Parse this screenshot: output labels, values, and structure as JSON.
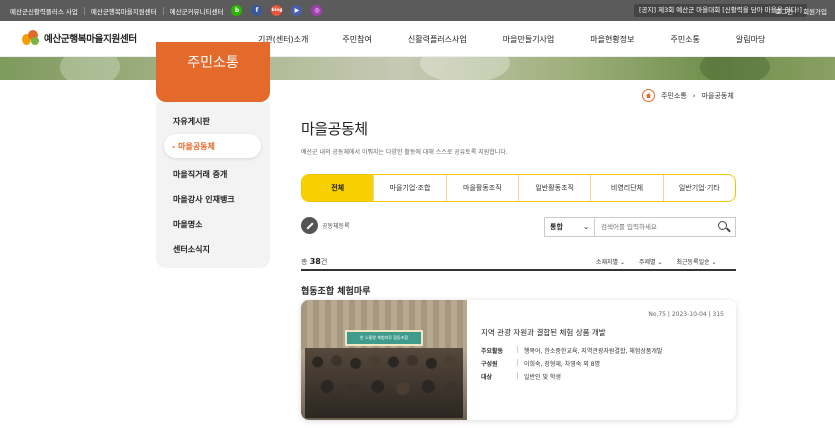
{
  "topbar": {
    "links": [
      "예산군신활력플러스 사업",
      "예산군행복마을지원센터",
      "예산군커뮤니티센터"
    ],
    "sns": [
      {
        "label": "b",
        "icon": "blog-icon",
        "color": "#2db400"
      },
      {
        "label": "f",
        "icon": "facebook-icon",
        "color": "#3b5998"
      },
      {
        "label": "blog",
        "icon": "naver-blog-icon",
        "color": "#e8543c"
      },
      {
        "label": "▶",
        "icon": "youtube-icon",
        "color": "#4c5fa8"
      },
      {
        "label": "◎",
        "icon": "instagram-icon",
        "color": "#a23fb1"
      }
    ],
    "notice": "[공지] 제3회 예산군 마을대회 [신활력을 담아 마을을 잇다!]",
    "login": "로그인",
    "signup": "회원가입"
  },
  "header": {
    "logo": "예산군행복마을지원센터",
    "nav": [
      "기관(센터)소개",
      "주민참여",
      "신활력플러스사업",
      "마을만들기사업",
      "마을현황정보",
      "주민소통",
      "알림마당"
    ]
  },
  "sidebar": {
    "title": "주민소통",
    "items": [
      "자유게시판",
      "- 마을공동체",
      "마을직거래 중개",
      "마을강사 인재뱅크",
      "마을명소",
      "센터소식지"
    ]
  },
  "breadcrumb": {
    "parent": "주민소통",
    "current": "마을공동체"
  },
  "page": {
    "title": "마을공동체",
    "description": "예산군 내의 공동체에서 이뤄지는 다양한 활동에 대해 스스로 공유토록 지원합니다."
  },
  "tabs": [
    "전체",
    "마을기업·조합",
    "마을활동조직",
    "일반활동조직",
    "비영리단체",
    "일반기업·기타"
  ],
  "toolbar": {
    "register": "공동체등록",
    "search_type": "통합",
    "search_placeholder": "검색어를 입력하세요"
  },
  "list": {
    "count_prefix": "총",
    "count": "38",
    "count_suffix": "건",
    "filters": [
      "소재지별 ⌄",
      "주제별 ⌄",
      "최근등록일순 ⌄"
    ]
  },
  "category": "협동조합 체험마루",
  "card": {
    "meta": "No.75 | 2023-10-04 | 315",
    "title": "지역 관광 자원과 결합된 체험 상품 개발",
    "photo_banner": "한 소통왕 체험마루 협동조합",
    "rows": [
      {
        "key": "주요활동",
        "value": "행복어, 한소중한교육, 지역관광자원결합, 체험상품개발"
      },
      {
        "key": "구성원",
        "value": "이희숙, 장형재, 차영숙 외 8명"
      },
      {
        "key": "대상",
        "value": "일반인 및 학생"
      }
    ]
  },
  "colors": {
    "accent": "#e46a2c",
    "tab_active": "#f8cf00",
    "topbar": "#5b5b5b"
  }
}
